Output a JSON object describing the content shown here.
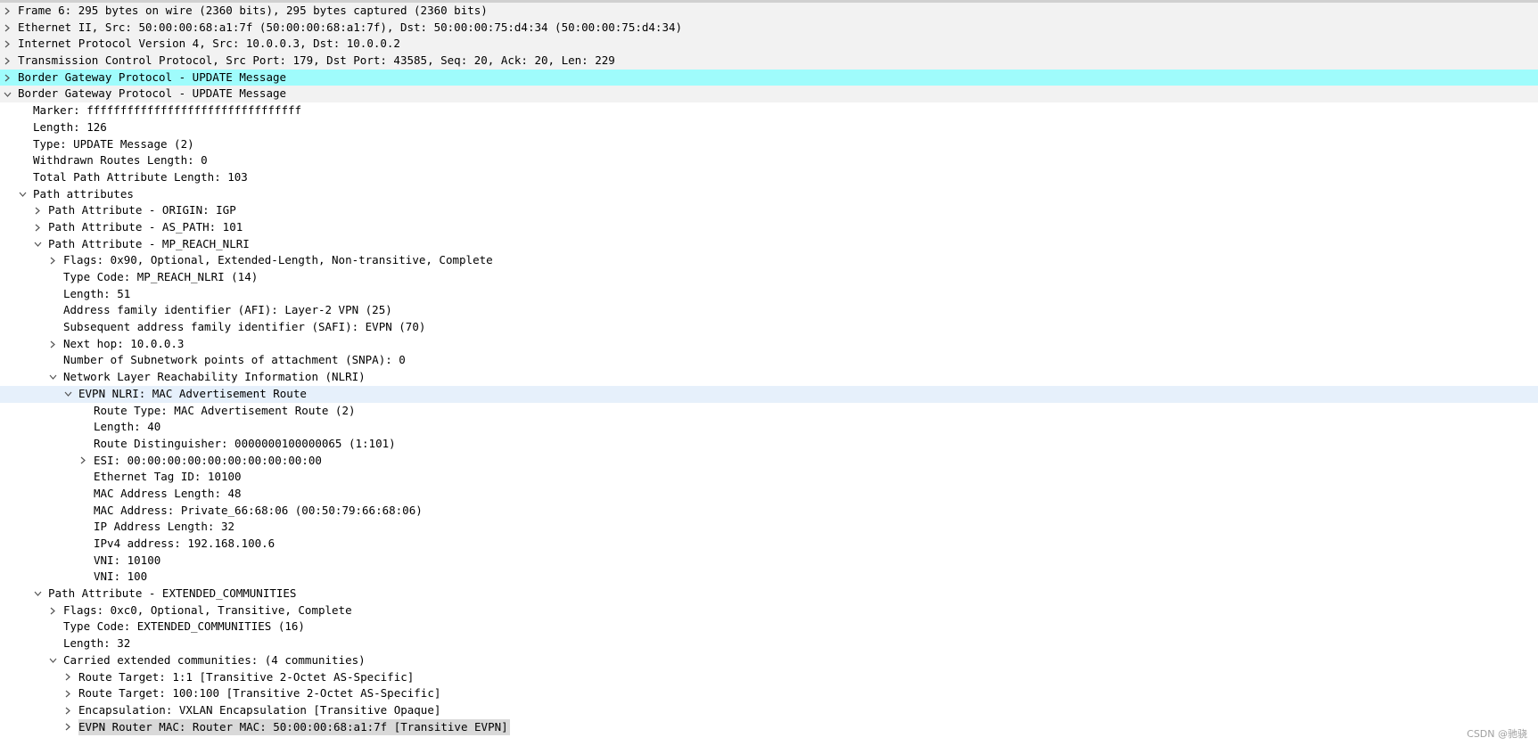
{
  "colors": {
    "selected_row": "#9ffcfc",
    "hover_row": "#e6f0fb",
    "focused_row": "#d9d9d9",
    "chevron": "#555555"
  },
  "icons": {
    "collapsed": "chevron-right-icon",
    "expanded": "chevron-down-icon"
  },
  "rows": [
    {
      "text": "Frame 6: 295 bytes on wire (2360 bits), 295 bytes captured (2360 bits)",
      "level": 0,
      "state": "collapsed",
      "hl": "stripe"
    },
    {
      "text": "Ethernet II, Src: 50:00:00:68:a1:7f (50:00:00:68:a1:7f), Dst: 50:00:00:75:d4:34 (50:00:00:75:d4:34)",
      "level": 0,
      "state": "collapsed",
      "hl": "stripe"
    },
    {
      "text": "Internet Protocol Version 4, Src: 10.0.0.3, Dst: 10.0.0.2",
      "level": 0,
      "state": "collapsed",
      "hl": "stripe"
    },
    {
      "text": "Transmission Control Protocol, Src Port: 179, Dst Port: 43585, Seq: 20, Ack: 20, Len: 229",
      "level": 0,
      "state": "collapsed",
      "hl": "stripe"
    },
    {
      "text": "Border Gateway Protocol - UPDATE Message",
      "level": 0,
      "state": "collapsed",
      "hl": "cyan"
    },
    {
      "text": "Border Gateway Protocol - UPDATE Message",
      "level": 0,
      "state": "expanded",
      "hl": "stripe"
    },
    {
      "text": "Marker: ffffffffffffffffffffffffffffffff",
      "level": 1,
      "state": "leaf",
      "hl": ""
    },
    {
      "text": "Length: 126",
      "level": 1,
      "state": "leaf",
      "hl": ""
    },
    {
      "text": "Type: UPDATE Message (2)",
      "level": 1,
      "state": "leaf",
      "hl": ""
    },
    {
      "text": "Withdrawn Routes Length: 0",
      "level": 1,
      "state": "leaf",
      "hl": ""
    },
    {
      "text": "Total Path Attribute Length: 103",
      "level": 1,
      "state": "leaf",
      "hl": ""
    },
    {
      "text": "Path attributes",
      "level": 1,
      "state": "expanded",
      "hl": ""
    },
    {
      "text": "Path Attribute - ORIGIN: IGP",
      "level": 2,
      "state": "collapsed",
      "hl": ""
    },
    {
      "text": "Path Attribute - AS_PATH: 101",
      "level": 2,
      "state": "collapsed",
      "hl": ""
    },
    {
      "text": "Path Attribute - MP_REACH_NLRI",
      "level": 2,
      "state": "expanded",
      "hl": ""
    },
    {
      "text": "Flags: 0x90, Optional, Extended-Length, Non-transitive, Complete",
      "level": 3,
      "state": "collapsed",
      "hl": ""
    },
    {
      "text": "Type Code: MP_REACH_NLRI (14)",
      "level": 3,
      "state": "leaf",
      "hl": ""
    },
    {
      "text": "Length: 51",
      "level": 3,
      "state": "leaf",
      "hl": ""
    },
    {
      "text": "Address family identifier (AFI): Layer-2 VPN (25)",
      "level": 3,
      "state": "leaf",
      "hl": ""
    },
    {
      "text": "Subsequent address family identifier (SAFI): EVPN (70)",
      "level": 3,
      "state": "leaf",
      "hl": ""
    },
    {
      "text": "Next hop: 10.0.0.3",
      "level": 3,
      "state": "collapsed",
      "hl": ""
    },
    {
      "text": "Number of Subnetwork points of attachment (SNPA): 0",
      "level": 3,
      "state": "leaf",
      "hl": ""
    },
    {
      "text": "Network Layer Reachability Information (NLRI)",
      "level": 3,
      "state": "expanded",
      "hl": ""
    },
    {
      "text": "EVPN NLRI: MAC Advertisement Route",
      "level": 4,
      "state": "expanded",
      "hl": "blue"
    },
    {
      "text": "Route Type: MAC Advertisement Route (2)",
      "level": 5,
      "state": "leaf",
      "hl": ""
    },
    {
      "text": "Length: 40",
      "level": 5,
      "state": "leaf",
      "hl": ""
    },
    {
      "text": "Route Distinguisher: 0000000100000065 (1:101)",
      "level": 5,
      "state": "leaf",
      "hl": ""
    },
    {
      "text": "ESI: 00:00:00:00:00:00:00:00:00:00",
      "level": 5,
      "state": "collapsed",
      "hl": ""
    },
    {
      "text": "Ethernet Tag ID: 10100",
      "level": 5,
      "state": "leaf",
      "hl": ""
    },
    {
      "text": "MAC Address Length: 48",
      "level": 5,
      "state": "leaf",
      "hl": ""
    },
    {
      "text": "MAC Address: Private_66:68:06 (00:50:79:66:68:06)",
      "level": 5,
      "state": "leaf",
      "hl": ""
    },
    {
      "text": "IP Address Length: 32",
      "level": 5,
      "state": "leaf",
      "hl": ""
    },
    {
      "text": "IPv4 address: 192.168.100.6",
      "level": 5,
      "state": "leaf",
      "hl": ""
    },
    {
      "text": "VNI: 10100",
      "level": 5,
      "state": "leaf",
      "hl": ""
    },
    {
      "text": "VNI: 100",
      "level": 5,
      "state": "leaf",
      "hl": ""
    },
    {
      "text": "Path Attribute - EXTENDED_COMMUNITIES",
      "level": 2,
      "state": "expanded",
      "hl": ""
    },
    {
      "text": "Flags: 0xc0, Optional, Transitive, Complete",
      "level": 3,
      "state": "collapsed",
      "hl": ""
    },
    {
      "text": "Type Code: EXTENDED_COMMUNITIES (16)",
      "level": 3,
      "state": "leaf",
      "hl": ""
    },
    {
      "text": "Length: 32",
      "level": 3,
      "state": "leaf",
      "hl": ""
    },
    {
      "text": "Carried extended communities: (4 communities)",
      "level": 3,
      "state": "expanded",
      "hl": ""
    },
    {
      "text": "Route Target: 1:1 [Transitive 2-Octet AS-Specific]",
      "level": 4,
      "state": "collapsed",
      "hl": ""
    },
    {
      "text": "Route Target: 100:100 [Transitive 2-Octet AS-Specific]",
      "level": 4,
      "state": "collapsed",
      "hl": ""
    },
    {
      "text": "Encapsulation: VXLAN Encapsulation [Transitive Opaque]",
      "level": 4,
      "state": "collapsed",
      "hl": ""
    },
    {
      "text": "EVPN Router MAC: Router MAC: 50:00:00:68:a1:7f [Transitive EVPN]",
      "level": 4,
      "state": "collapsed",
      "hl": "grey"
    }
  ],
  "watermark": "CSDN @驰骁"
}
